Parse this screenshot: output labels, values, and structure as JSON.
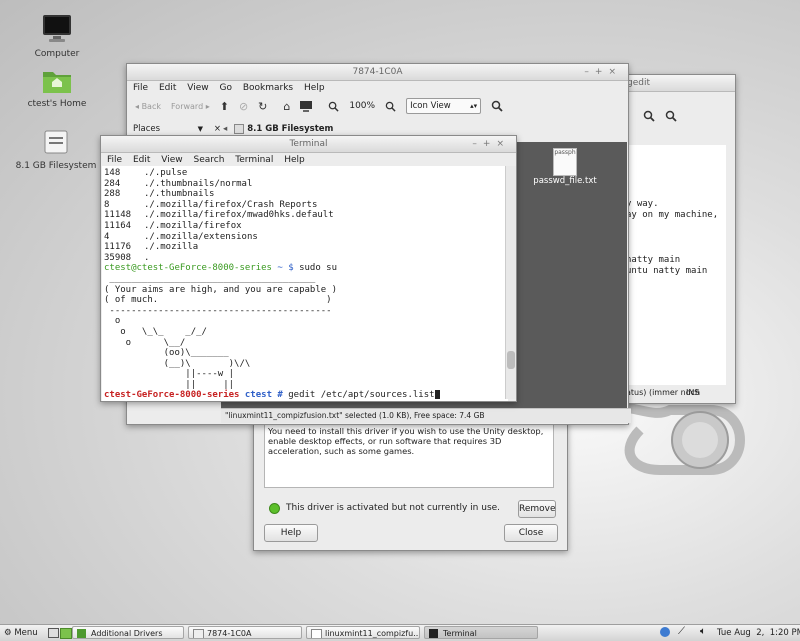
{
  "desktop": {
    "icons": [
      {
        "label": "Computer"
      },
      {
        "label": "ctest's Home"
      },
      {
        "label": "8.1 GB Filesystem"
      }
    ]
  },
  "gedit": {
    "title": "gedit",
    "text_lines": [
      "y way.",
      "ay on my machine,",
      "",
      "",
      "natty main",
      "untu natty main"
    ],
    "status": {
      "left": "atus)  (immer noch",
      "ins": "INS"
    }
  },
  "file_manager": {
    "title": "7874-1C0A",
    "menu": [
      "File",
      "Edit",
      "View",
      "Go",
      "Bookmarks",
      "Help"
    ],
    "toolbar": {
      "back": "Back",
      "forward": "Forward",
      "zoom": "100%",
      "view_mode": "Icon View"
    },
    "sidebar_label": "Places",
    "location": "8.1 GB Filesystem",
    "file": {
      "name": "passwd_file.txt",
      "thumb_text": "passph"
    },
    "statusbar": "\"linuxmint11_compizfusion.txt\" selected (1.0 KB), Free space: 7.4 GB"
  },
  "terminal": {
    "title": "Terminal",
    "menu": [
      "File",
      "Edit",
      "View",
      "Search",
      "Terminal",
      "Help"
    ],
    "du_lines": [
      [
        "148",
        "./.pulse"
      ],
      [
        "284",
        "./.thumbnails/normal"
      ],
      [
        "288",
        "./.thumbnails"
      ],
      [
        "8",
        "./.mozilla/firefox/Crash Reports"
      ],
      [
        "11148",
        "./.mozilla/firefox/mwad0hks.default"
      ],
      [
        "11164",
        "./.mozilla/firefox"
      ],
      [
        "4",
        "./.mozilla/extensions"
      ],
      [
        "11176",
        "./.mozilla"
      ],
      [
        "35908",
        "."
      ]
    ],
    "prompt_user": "ctest@ctest-GeForce-8000-series",
    "prompt_path": "~ $",
    "command1": "sudo su",
    "cowsay": [
      " ______________________________________",
      "( Your aims are high, and you are capable )",
      "( of much.                               )",
      " -----------------------------------------",
      "  o",
      "   o   \\_\\_    _/_/",
      "    o      \\__/",
      "           (oo)\\_______",
      "           (__)\\       )\\/\\",
      "               ||----w |",
      "               ||     ||"
    ],
    "root_host": "ctest-GeForce-8000-series",
    "root_path": "ctest #",
    "command2": "gedit /etc/apt/sources.list"
  },
  "drivers_dialog": {
    "description": "You need to install this driver if you wish to use the Unity desktop, enable desktop effects, or run software that requires 3D acceleration, such as some games.",
    "status": "This driver is activated but not currently in use.",
    "remove_label": "Remove",
    "help_label": "Help",
    "close_label": "Close"
  },
  "taskbar": {
    "menu_label": "Menu",
    "tasks": [
      "Additional Drivers",
      "7874-1C0A",
      "linuxmint11_compizfu...",
      "Terminal"
    ],
    "clock": "Tue Aug  2,  1:20 PM"
  },
  "colors": {
    "prompt_green": "#3a9a21",
    "root_red": "#c72222",
    "path_blue": "#3060c8",
    "mint_green": "#6cb33f"
  }
}
